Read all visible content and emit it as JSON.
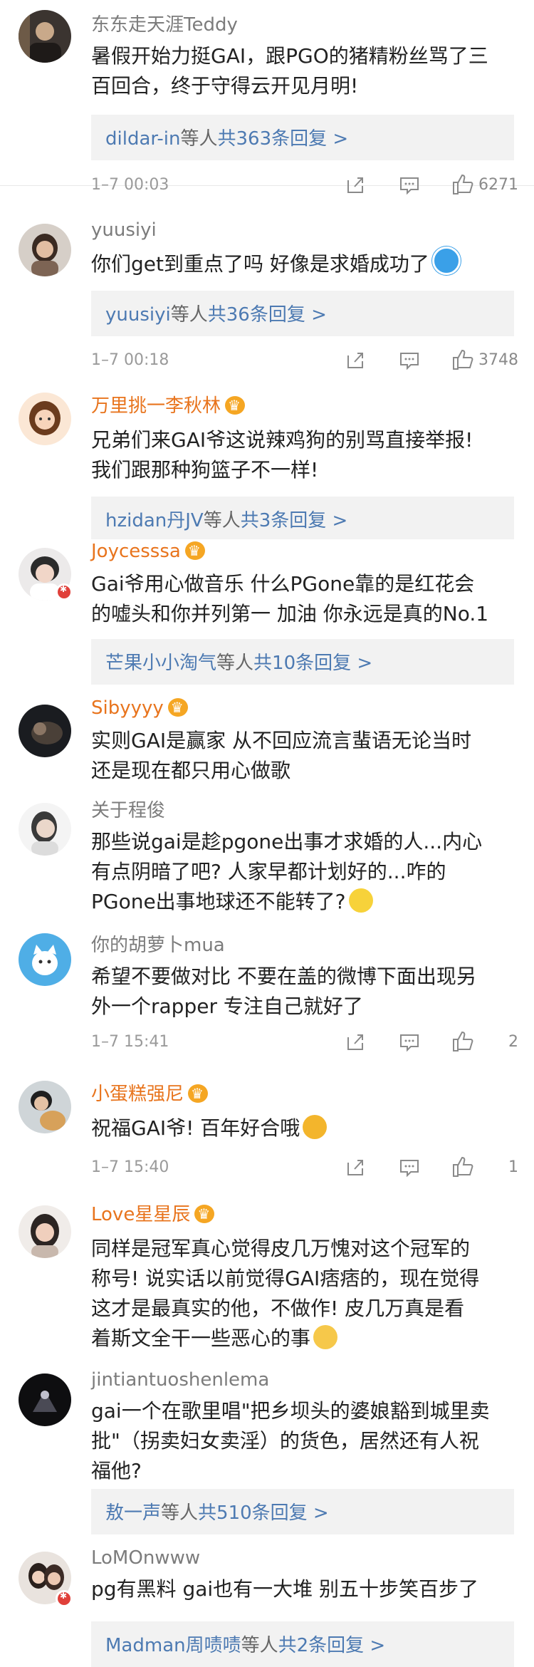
{
  "comments": [
    {
      "user": "东东走天涯Teddy",
      "lines": [
        "暑假开始力挺GAI，跟PGO的猪精粉丝骂了三",
        "百回合，终于守得云开见月明!"
      ],
      "reply_who": "dildar-in",
      "reply_sep": "等人",
      "reply_count": "共363条回复 >",
      "time": "1–7 00:03",
      "likes": "6271"
    },
    {
      "user": "yuusiyi",
      "lines": [
        "你们get到重点了吗 好像是求婚成功了"
      ],
      "reply_who": "yuusiyi",
      "reply_sep": "等人",
      "reply_count": "共36条回复 >",
      "time": "1–7 00:18",
      "likes": "3748"
    },
    {
      "user": "万里挑一李秋林",
      "lines": [
        "兄弟们来GAI爷这说辣鸡狗的别骂直接举报!",
        "我们跟那种狗篮子不一样!"
      ],
      "reply_who": "hzidan丹JV",
      "reply_sep": "等人",
      "reply_count": "共3条回复 >"
    },
    {
      "user": "Joycesssa",
      "lines": [
        "Gai爷用心做音乐 什么PGone靠的是红花会",
        "的嘘头和你并列第一 加油 你永远是真的No.1"
      ],
      "reply_who": "芒果小小淘气",
      "reply_sep": "等人",
      "reply_count": "共10条回复 >"
    },
    {
      "user": "Sibyyyy",
      "lines": [
        "实则GAI是赢家 从不回应流言蜚语无论当时",
        "还是现在都只用心做歌"
      ]
    },
    {
      "user": "关于程俊",
      "lines": [
        "那些说gai是趁pgone出事才求婚的人...内心",
        "有点阴暗了吧? 人家早都计划好的...咋的",
        "PGone出事地球还不能转了?"
      ]
    },
    {
      "user": "你的胡萝卜mua",
      "lines": [
        "希望不要做对比 不要在盖的微博下面出现另",
        "外一个rapper 专注自己就好了"
      ],
      "time": "1–7 15:41",
      "likes": "2"
    },
    {
      "user": "小蛋糕强尼",
      "lines": [
        "祝福GAI爷! 百年好合哦"
      ],
      "time": "1–7 15:40",
      "likes": "1"
    },
    {
      "user": "Love星星辰",
      "lines": [
        "同样是冠军真心觉得皮几万愧对这个冠军的",
        "称号! 说实话以前觉得GAI痞痞的，现在觉得",
        "这才是最真实的他，不做作! 皮几万真是看",
        "着斯文全干一些恶心的事"
      ]
    },
    {
      "user": "jintiantuoshenlema",
      "lines": [
        "gai一个在歌里唱\"把乡坝头的婆娘豁到城里卖",
        "批\"（拐卖妇女卖淫）的货色，居然还有人祝",
        "福他?"
      ],
      "reply_who": "敖一声",
      "reply_sep": "等人",
      "reply_count": "共510条回复 >"
    },
    {
      "user": "LoMOnwww",
      "lines": [
        "pg有黑料 gai也有一大堆 别五十步笑百步了"
      ],
      "reply_who": "Madman周啧啧",
      "reply_sep": "等人",
      "reply_count": "共2条回复 >"
    }
  ],
  "icons": {
    "share": "share-icon",
    "reply": "comment-icon",
    "like": "thumb-up-icon",
    "crown": "crown-icon",
    "verified": "verified-badge-icon"
  },
  "colors": {
    "vip_name": "#e8741d",
    "link": "#4d7ab2",
    "reply_bg": "#f2f2f2",
    "divider": "#e8e8e8"
  }
}
